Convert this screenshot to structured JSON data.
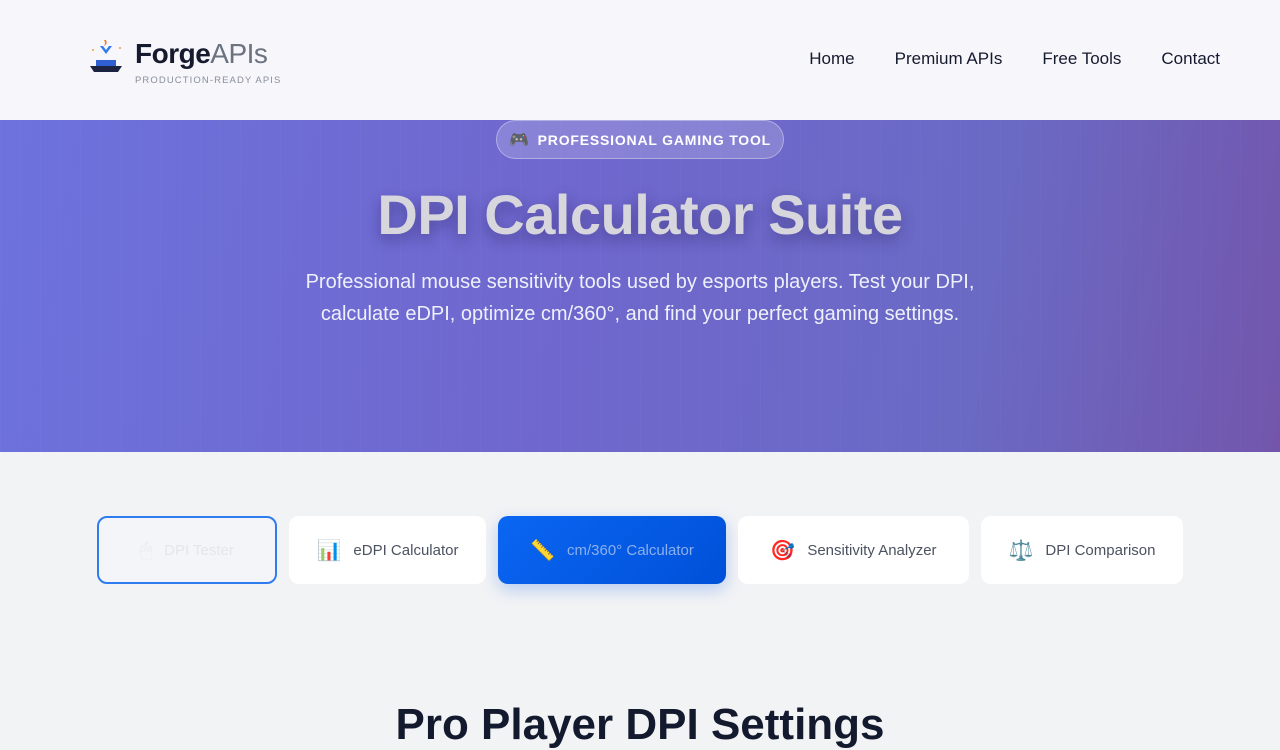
{
  "header": {
    "brand_bold": "Forge",
    "brand_light": "APIs",
    "tagline": "PRODUCTION-READY APIS",
    "nav": [
      "Home",
      "Premium APIs",
      "Free Tools",
      "Contact"
    ]
  },
  "hero": {
    "badge_icon": "🎮",
    "badge_label": "PROFESSIONAL GAMING TOOL",
    "title": "DPI Calculator Suite",
    "subtitle": "Professional mouse sensitivity tools used by esports players. Test your DPI, calculate eDPI, optimize cm/360°, and find your perfect gaming settings."
  },
  "tabs": [
    {
      "icon": "🖱",
      "label": "DPI Tester",
      "state": "focused"
    },
    {
      "icon": "📊",
      "label": "eDPI Calculator"
    },
    {
      "icon": "📏",
      "label": "cm/360° Calculator",
      "state": "active"
    },
    {
      "icon": "🎯",
      "label": "Sensitivity Analyzer"
    },
    {
      "icon": "⚖️",
      "label": "DPI Comparison"
    }
  ],
  "section": {
    "title": "Pro Player DPI Settings"
  },
  "colors": {
    "active_tab": "#0a66f2",
    "hero_gradient_start": "#6d72dd",
    "hero_gradient_end": "#7356ac"
  }
}
